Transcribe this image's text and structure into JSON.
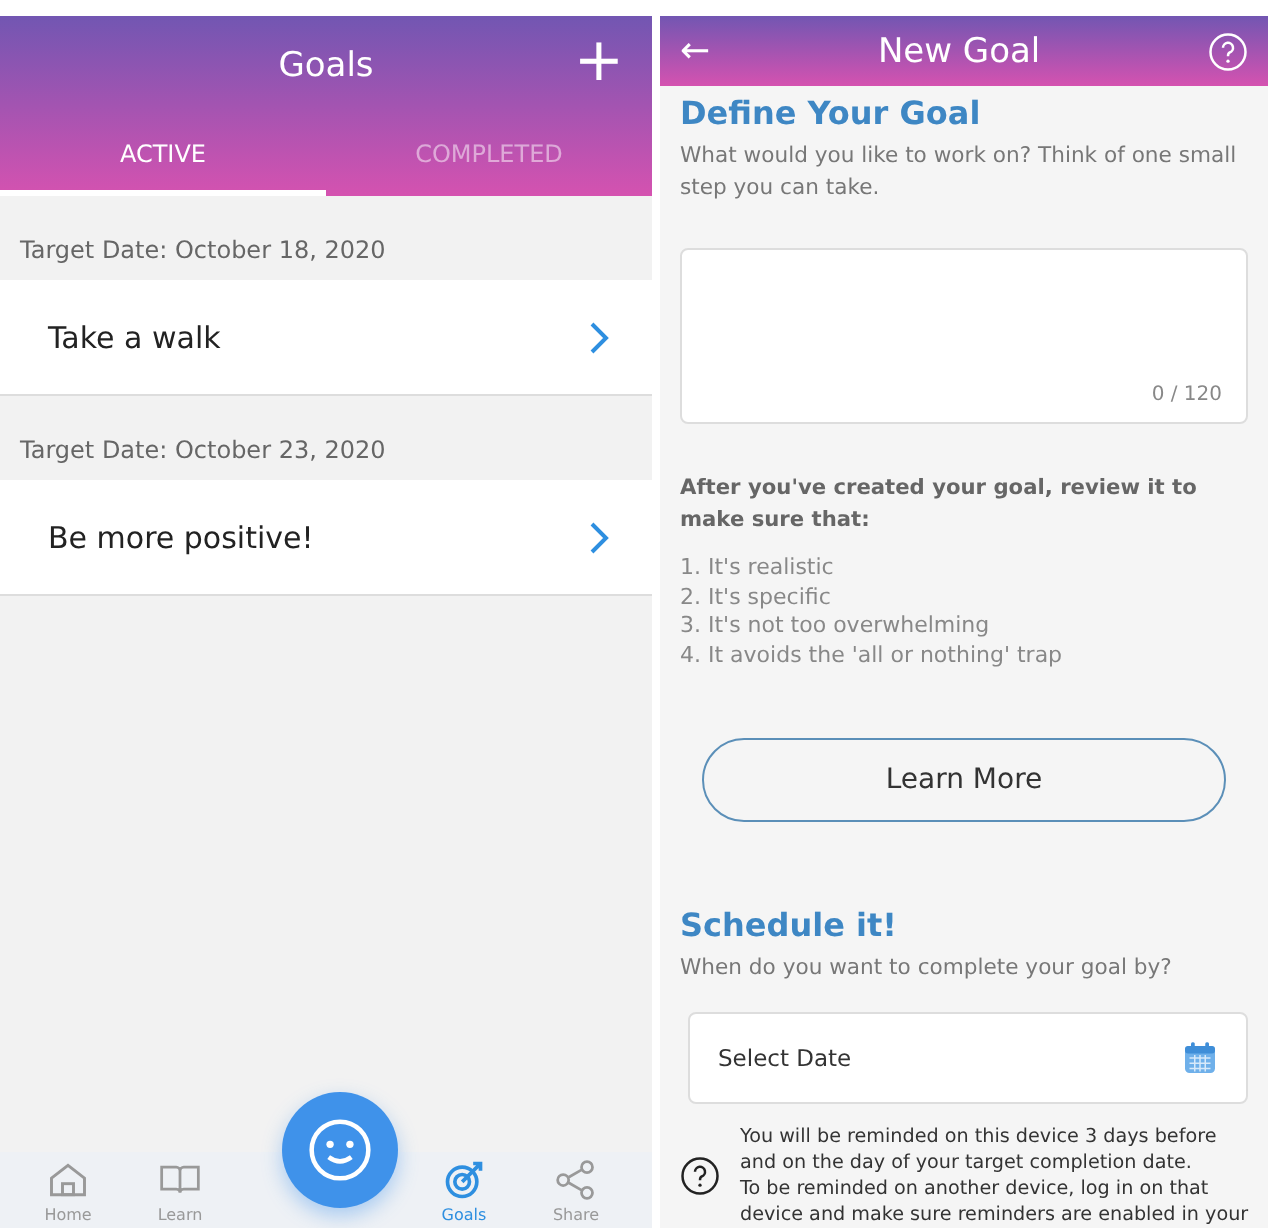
{
  "goals_screen": {
    "title": "Goals",
    "add_button": "+",
    "tabs": [
      {
        "label": "ACTIVE",
        "selected": true
      },
      {
        "label": "COMPLETED",
        "selected": false
      }
    ],
    "goals": [
      {
        "target_date": "Target Date: October 18, 2020",
        "name": "Take a walk"
      },
      {
        "target_date": "Target Date: October 23, 2020",
        "name": "Be more positive!"
      }
    ],
    "nav": [
      {
        "label": "Home",
        "selected": false
      },
      {
        "label": "Learn",
        "selected": false
      },
      {
        "label": "Goals",
        "selected": true
      },
      {
        "label": "Share",
        "selected": false
      }
    ]
  },
  "new_goal_screen": {
    "back_button": "←",
    "title": "New Goal",
    "define": {
      "heading": "Define Your Goal",
      "text": "What would you like to work on? Think of one small step you can take.",
      "counter": "0 / 120"
    },
    "review": {
      "heading": "After you've created your goal, review it to make sure that:",
      "items": [
        "1. It's realistic",
        "2. It's specific",
        "3. It's not too overwhelming",
        "4. It avoids the 'all or nothing' trap"
      ]
    },
    "learn_more_button": "Learn More",
    "schedule": {
      "heading": "Schedule it!",
      "text": "When do you want to complete your goal by?",
      "date_placeholder": "Select Date"
    },
    "reminder_note": [
      "You will be reminded on this device 3 days before",
      "and on the day of your target completion date.",
      "To be reminded on another device, log in on that",
      "device and make sure reminders are enabled in your"
    ]
  }
}
